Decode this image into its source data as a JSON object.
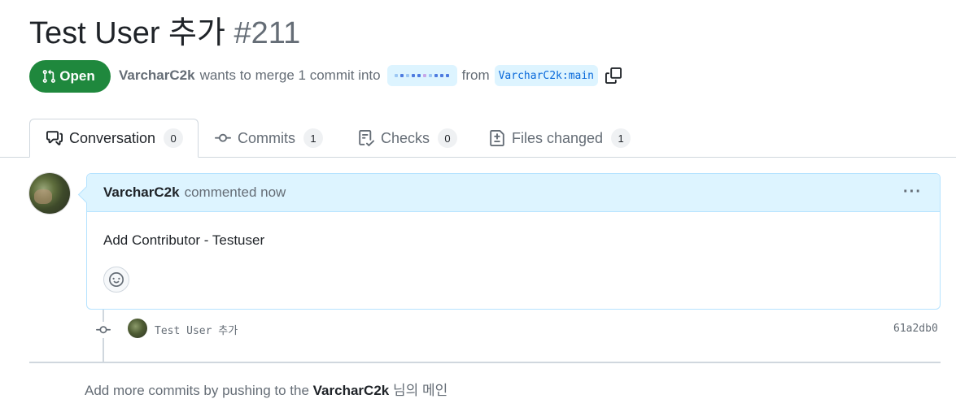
{
  "pr": {
    "title": "Test User 추가",
    "number": "#211",
    "state": "Open",
    "author": "VarcharC2k",
    "merge_text": "wants to merge 1 commit into",
    "from_text": "from",
    "head_branch": "VarcharC2k:main"
  },
  "tabs": [
    {
      "label": "Conversation",
      "count": "0",
      "icon": "comment-discussion-icon"
    },
    {
      "label": "Commits",
      "count": "1",
      "icon": "git-commit-icon"
    },
    {
      "label": "Checks",
      "count": "0",
      "icon": "checklist-icon"
    },
    {
      "label": "Files changed",
      "count": "1",
      "icon": "file-diff-icon"
    }
  ],
  "comment": {
    "author": "VarcharC2k",
    "meta": "commented now",
    "body": "Add Contributor - Testuser"
  },
  "commit": {
    "message": "Test User 추가",
    "sha": "61a2db0"
  },
  "footer": {
    "pre": "Add more commits by pushing to the",
    "author": "VarcharC2k",
    "post": "님의 메인"
  },
  "colors": {
    "open_green": "#1f883d",
    "branch_bg": "#ddf4ff",
    "branch_fg": "#0969da",
    "muted": "#656d76"
  }
}
